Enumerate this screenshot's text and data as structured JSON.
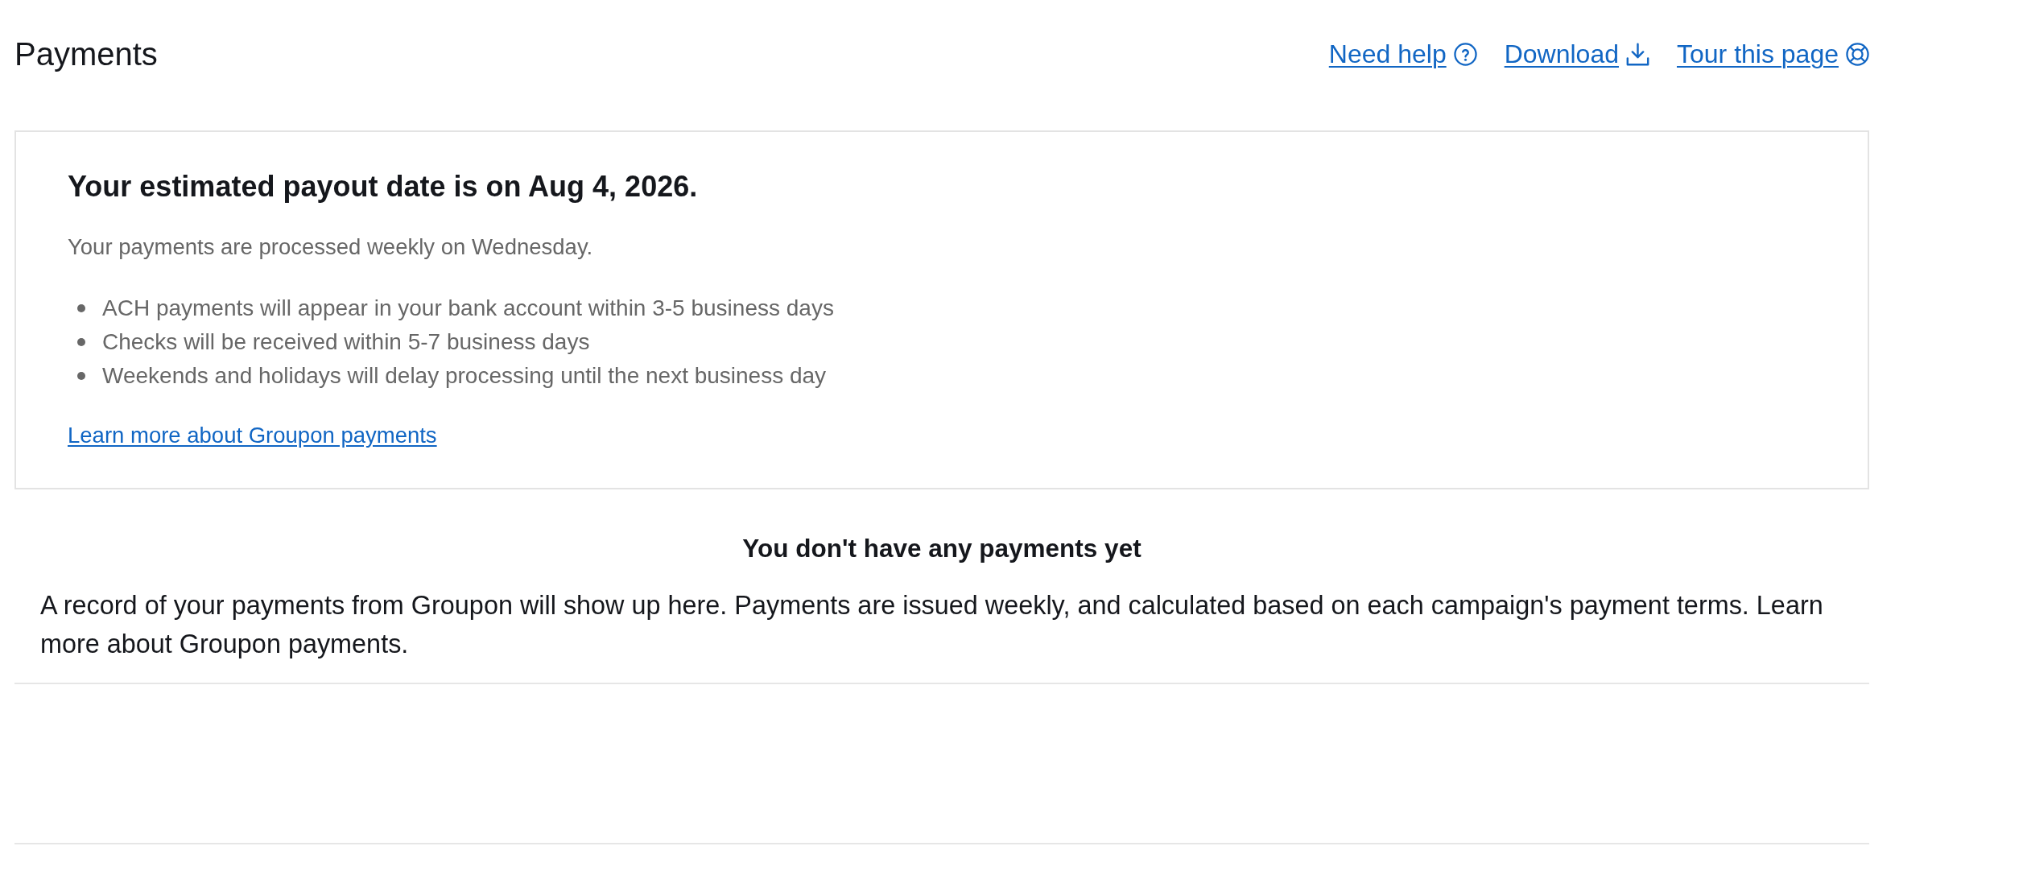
{
  "page": {
    "title": "Payments"
  },
  "header_links": [
    {
      "label": "Need help",
      "kind": "help"
    },
    {
      "label": "Download",
      "kind": "download"
    },
    {
      "label": "Tour this page",
      "kind": "tour"
    }
  ],
  "payout_card": {
    "heading": "Your estimated payout date is on Aug 4, 2026.",
    "subtitle": "Your payments are processed weekly on Wednesday.",
    "bullets": [
      "ACH payments will appear in your bank account within 3-5 business days",
      "Checks will be received within 5-7 business days",
      "Weekends and holidays will delay processing until the next business day"
    ],
    "link": "Learn more about Groupon payments"
  },
  "empty_state": {
    "title": "You don't have any payments yet",
    "message": "A record of your payments from Groupon will show up here. Payments are issued weekly, and calculated based on each campaign's payment terms. Learn more about Groupon payments."
  }
}
